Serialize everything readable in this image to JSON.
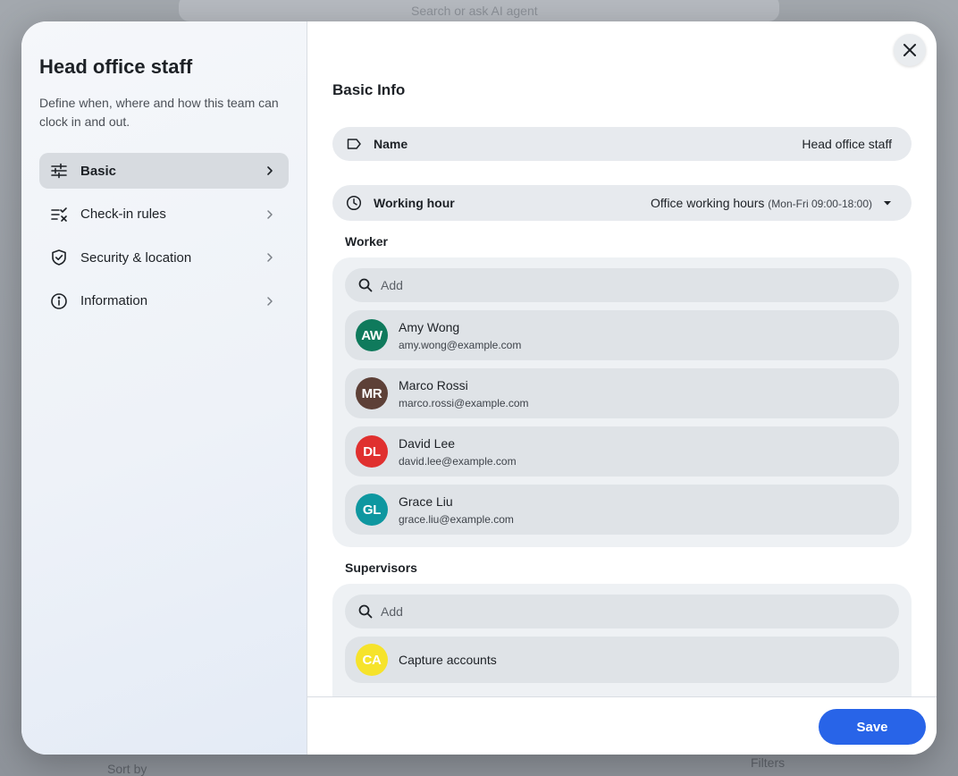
{
  "backdrop": {
    "search_placeholder": "Search or ask AI agent",
    "bottom_left": "Sort by",
    "bottom_right": "Filters"
  },
  "sidebar": {
    "title": "Head office staff",
    "description": "Define when, where and how this team can clock in and out.",
    "items": [
      {
        "label": "Basic",
        "icon": "sliders-icon",
        "active": true
      },
      {
        "label": "Check-in rules",
        "icon": "checklist-icon",
        "active": false
      },
      {
        "label": "Security & location",
        "icon": "shield-check-icon",
        "active": false
      },
      {
        "label": "Information",
        "icon": "info-icon",
        "active": false
      }
    ]
  },
  "main": {
    "section_title": "Basic Info",
    "name_field": {
      "label": "Name",
      "value": "Head office staff",
      "icon": "tag-icon"
    },
    "working_hour": {
      "label": "Working hour",
      "value": "Office working hours",
      "detail": "(Mon-Fri 09:00-18:00)",
      "icon": "clock-icon"
    },
    "workers": {
      "label": "Worker",
      "search_placeholder": "Add",
      "people": [
        {
          "initials": "AW",
          "name": "Amy Wong",
          "email": "amy.wong@example.com",
          "color": "#0f7a5c"
        },
        {
          "initials": "MR",
          "name": "Marco Rossi",
          "email": "marco.rossi@example.com",
          "color": "#5d4037"
        },
        {
          "initials": "DL",
          "name": "David Lee",
          "email": "david.lee@example.com",
          "color": "#e0302f"
        },
        {
          "initials": "GL",
          "name": "Grace Liu",
          "email": "grace.liu@example.com",
          "color": "#0e97a0"
        }
      ]
    },
    "supervisors": {
      "label": "Supervisors",
      "search_placeholder": "Add",
      "people": [
        {
          "initials": "CA",
          "name": "Capture accounts",
          "color": "#f6e32b"
        }
      ]
    }
  },
  "footer": {
    "save_label": "Save"
  },
  "colors": {
    "accent": "#2864e8"
  }
}
